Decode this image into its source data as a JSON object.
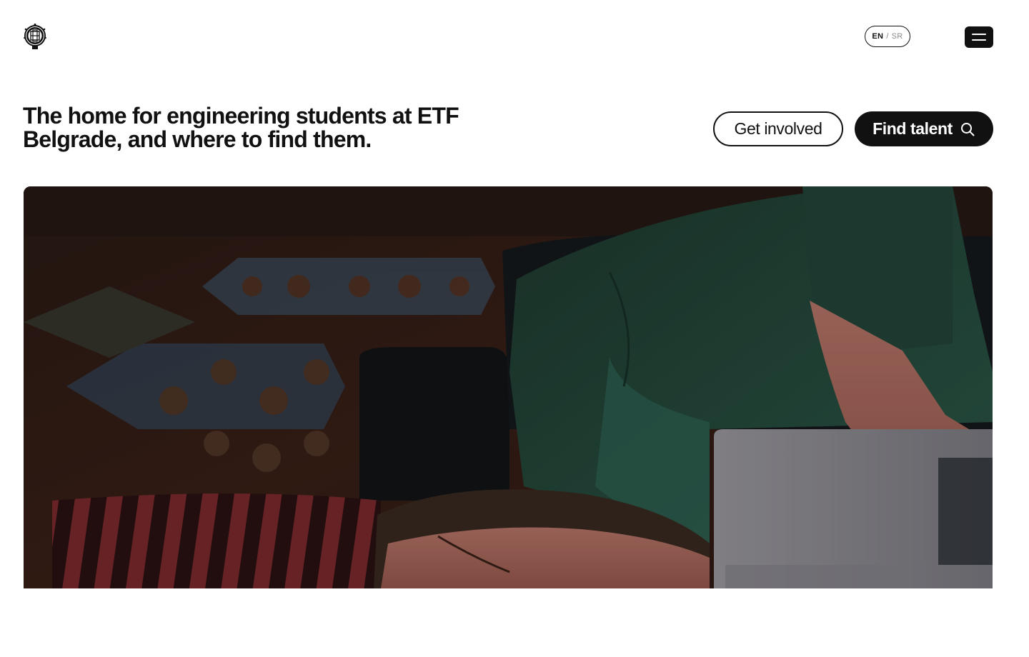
{
  "header": {
    "logo_icon": "university-seal-logo",
    "language": {
      "active": "EN",
      "separator": "/",
      "inactive": "SR"
    },
    "menu_icon": "hamburger-menu-icon"
  },
  "hero": {
    "headline": "The home for engineering students at ETF Belgrade, and where to find them.",
    "get_involved_label": "Get involved",
    "find_talent_label": "Find talent",
    "find_talent_icon": "search-icon"
  },
  "colors": {
    "primary": "#111111",
    "background": "#ffffff",
    "inactive_text": "#8a8a8a"
  }
}
